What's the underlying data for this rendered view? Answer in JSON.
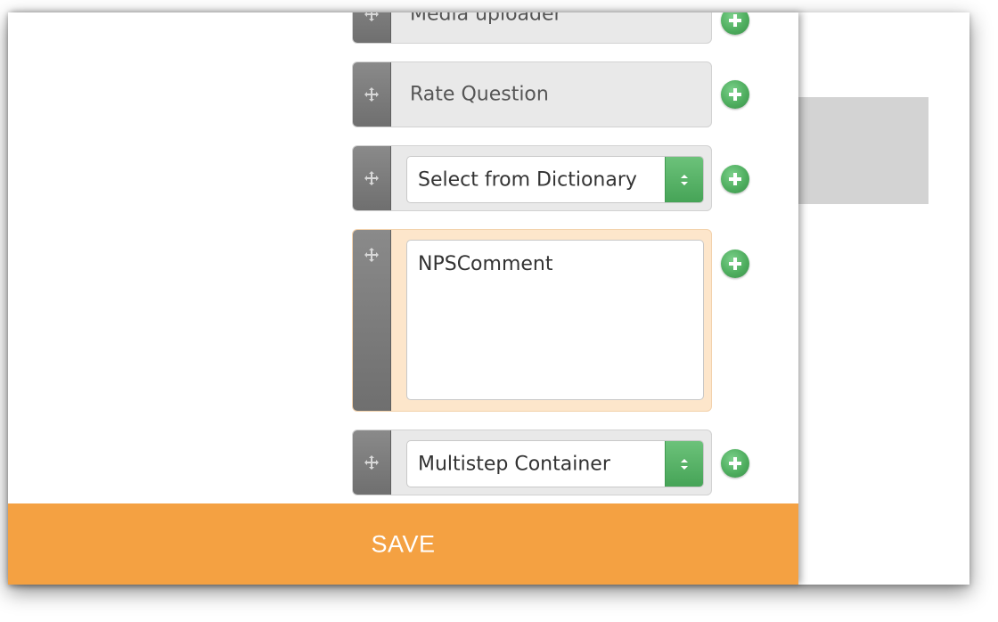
{
  "components": [
    {
      "label": "Media uploader",
      "kind": "label"
    },
    {
      "label": "Rate Question",
      "kind": "label"
    },
    {
      "label": "Select from Dictionary",
      "kind": "select"
    },
    {
      "label": "NPSComment",
      "kind": "textarea"
    },
    {
      "label": "Multistep Container",
      "kind": "select"
    }
  ],
  "footer": {
    "save_label": "SAVE"
  },
  "icons": {
    "drag": "move-icon",
    "add": "plus-icon",
    "select_arrow": "updown-arrows-icon"
  },
  "colors": {
    "save_bar": "#f4a142",
    "add_button": "#4fae5f",
    "handle": "#7a7a7a",
    "field_bg": "#e9e9e9",
    "highlight_bg": "#fde6cb"
  }
}
